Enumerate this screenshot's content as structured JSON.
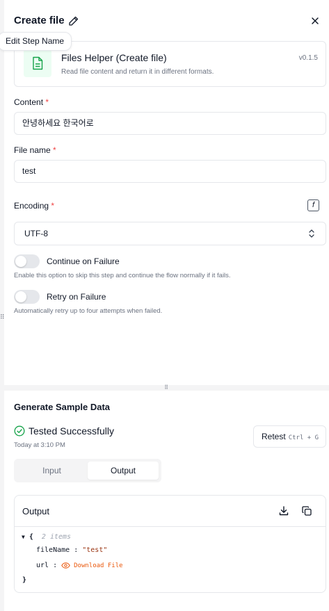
{
  "header": {
    "title": "Create file",
    "tooltip": "Edit Step Name"
  },
  "piece": {
    "name": "Files Helper (Create file)",
    "description": "Read file content and return it in different formats.",
    "version": "v0.1.5",
    "accent_color": "#16a34a"
  },
  "fields": {
    "content": {
      "label": "Content",
      "required_mark": "*",
      "value": "안녕하세요 한국어로"
    },
    "file_name": {
      "label": "File name",
      "required_mark": "*",
      "value": "test"
    },
    "encoding": {
      "label": "Encoding",
      "required_mark": "*",
      "value": "UTF-8",
      "fx_label": "f"
    }
  },
  "toggles": {
    "continue_on_failure": {
      "label": "Continue on Failure",
      "help": "Enable this option to skip this step and continue the flow normally if it fails.",
      "enabled": false
    },
    "retry_on_failure": {
      "label": "Retry on Failure",
      "help": "Automatically retry up to four attempts when failed.",
      "enabled": false
    }
  },
  "sample": {
    "title": "Generate Sample Data",
    "status": "Tested Successfully",
    "status_color": "#16a34a",
    "time": "Today at 3:10 PM",
    "retest_label": "Retest",
    "retest_shortcut": "Ctrl + G",
    "tabs": {
      "input": "Input",
      "output": "Output",
      "active": "Output"
    }
  },
  "output": {
    "title": "Output",
    "open_brace": "{",
    "close_brace": "}",
    "item_count": "2 items",
    "rows": [
      {
        "key": "fileName",
        "sep": " : ",
        "value": "\"test\""
      },
      {
        "key": "url",
        "sep": " : ",
        "link": "Download File"
      }
    ]
  }
}
